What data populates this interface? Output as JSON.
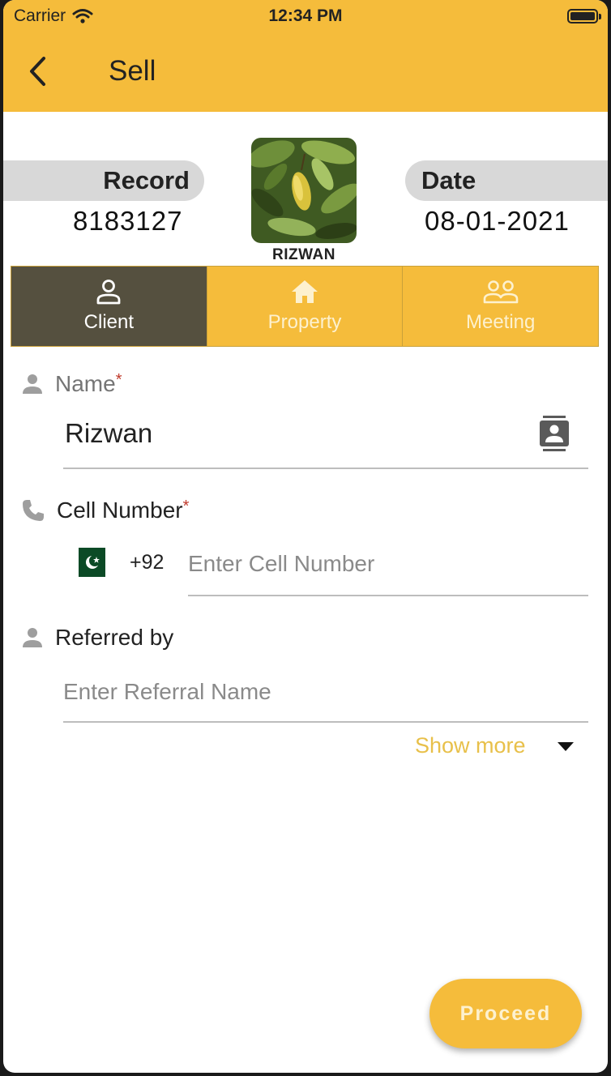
{
  "status_bar": {
    "carrier": "Carrier",
    "time": "12:34 PM"
  },
  "appbar": {
    "title": "Sell"
  },
  "record": {
    "label": "Record",
    "value": "8183127"
  },
  "date": {
    "label": "Date",
    "value": "08-01-2021"
  },
  "avatar": {
    "name": "RIZWAN"
  },
  "tabs": [
    {
      "label": "Client",
      "icon": "person-outline-icon",
      "active": true
    },
    {
      "label": "Property",
      "icon": "home-icon",
      "active": false
    },
    {
      "label": "Meeting",
      "icon": "people-outline-icon",
      "active": false
    }
  ],
  "form": {
    "name": {
      "label": "Name",
      "required_mark": "*",
      "value": "Rizwan"
    },
    "cell": {
      "label": "Cell Number",
      "required_mark": "*",
      "country_code": "+92",
      "placeholder": "Enter Cell Number"
    },
    "referred": {
      "label": "Referred by",
      "placeholder": "Enter Referral Name"
    },
    "show_more": "Show more"
  },
  "proceed_label": "Proceed",
  "colors": {
    "accent": "#f5bc3b",
    "active_tab": "#55503f",
    "link": "#e8c04a"
  }
}
